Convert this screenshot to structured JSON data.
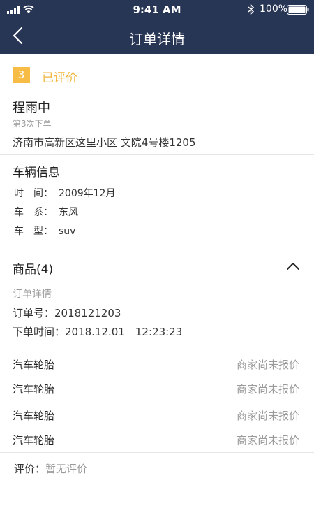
{
  "status_bar": {
    "time": "9:41 AM",
    "battery_pct": "100%",
    "icons": [
      "signal-icon",
      "wifi-icon",
      "bluetooth-icon",
      "battery-icon"
    ]
  },
  "nav": {
    "title": "订单详情",
    "back_icon": "chevron-left-icon"
  },
  "order_state": {
    "number": "3",
    "text": "已评价",
    "color": "#f6bc45"
  },
  "customer": {
    "name": "程雨中",
    "order_count": "第3次下单",
    "address": "济南市高新区这里小区 文院4号楼1205"
  },
  "vehicle": {
    "title": "车辆信息",
    "rows": [
      {
        "label": "时　间：",
        "value": "2009年12月"
      },
      {
        "label": "车　系：",
        "value": "东风"
      },
      {
        "label": "车　型：",
        "value": "suv"
      }
    ]
  },
  "goods": {
    "title": "商品(4)",
    "expanded_icon": "chevron-up-icon",
    "order_detail_label": "订单详情",
    "order_no": "订单号：2018121203",
    "order_time": "下单时间：2018.12.01　12:23:23",
    "items": [
      {
        "name": "汽车轮胎",
        "status": "商家尚未报价"
      },
      {
        "name": "汽车轮胎",
        "status": "商家尚未报价"
      },
      {
        "name": "汽车轮胎",
        "status": "商家尚未报价"
      },
      {
        "name": "汽车轮胎",
        "status": "商家尚未报价"
      }
    ]
  },
  "rating": {
    "label": "评价：",
    "value": "暂无评价"
  },
  "colors": {
    "nav_bg": "#283655",
    "accent": "#f2b63d",
    "muted": "#9a9a9a"
  }
}
